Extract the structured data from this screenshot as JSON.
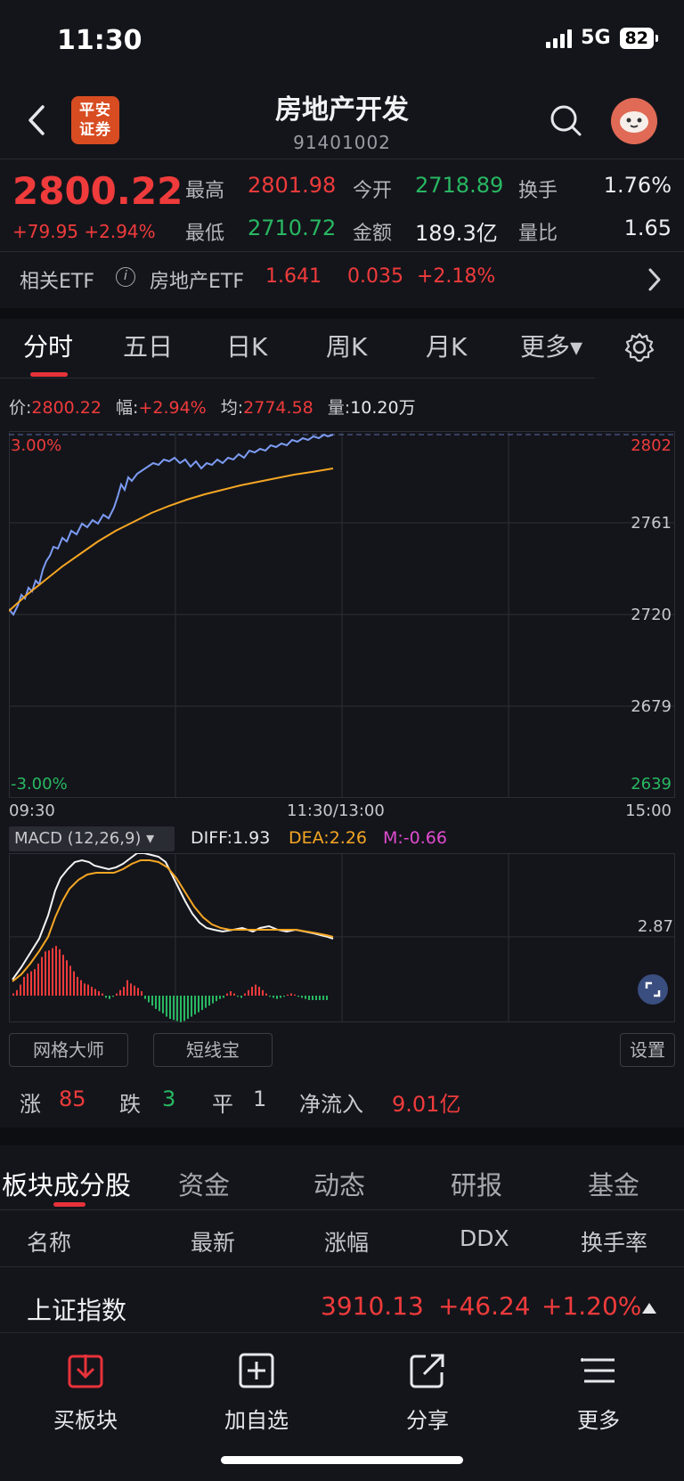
{
  "status": {
    "time": "11:30",
    "network": "5G",
    "battery": "82"
  },
  "header": {
    "logo_text_1": "平安",
    "logo_text_2": "证券",
    "title": "房地产开发",
    "code": "91401002"
  },
  "quote": {
    "price": "2800.22",
    "change": "+79.95 +2.94%",
    "high_label": "最高",
    "high": "2801.98",
    "open_label": "今开",
    "open": "2718.89",
    "turnover_label": "换手",
    "turnover": "1.76%",
    "low_label": "最低",
    "low": "2710.72",
    "amount_label": "金额",
    "amount": "189.3亿",
    "vol_ratio_label": "量比",
    "vol_ratio": "1.65"
  },
  "etf": {
    "label": "相关ETF",
    "info_icon": "i",
    "name": "房地产ETF",
    "price": "1.641",
    "change": "0.035",
    "pct": "+2.18%"
  },
  "tabs": [
    "分时",
    "五日",
    "日K",
    "周K",
    "月K",
    "更多▾"
  ],
  "infoline": {
    "price_label": "价:",
    "price": "2800.22",
    "amp_label": "幅:",
    "amp": "+2.94%",
    "avg_label": "均:",
    "avg": "2774.58",
    "vol_label": "量:",
    "vol": "10.20万"
  },
  "intraday": {
    "y_right": [
      "2802",
      "2761",
      "2720",
      "2679",
      "2639"
    ],
    "pct_top": "3.00%",
    "pct_bottom": "-3.00%",
    "x_labels": [
      "09:30",
      "11:30/13:00",
      "15:00"
    ]
  },
  "macd": {
    "label": "MACD (12,26,9) ▾",
    "diff": "DIFF:1.93",
    "dea": "DEA:2.26",
    "m": "M:-0.66",
    "right_value": "2.87"
  },
  "tools": {
    "grid": "网格大师",
    "short": "短线宝",
    "settings": "设置"
  },
  "stats": {
    "up_label": "涨",
    "up": "85",
    "down_label": "跌",
    "down": "3",
    "flat_label": "平",
    "flat": "1",
    "inflow_label": "净流入",
    "inflow": "9.01亿"
  },
  "sub_tabs": [
    "板块成分股",
    "资金",
    "动态",
    "研报",
    "基金"
  ],
  "columns": [
    "名称",
    "最新",
    "涨幅",
    "DDX",
    "换手率"
  ],
  "row": {
    "name": "上证指数",
    "last": "3910.13",
    "chg": "+46.24",
    "pct": "+1.20%"
  },
  "bottom": {
    "buy": "买板块",
    "add": "加自选",
    "share": "分享",
    "more": "更多"
  },
  "colors": {
    "up": "#ef3b3b",
    "down": "#28b862",
    "price_line": "#7c9cf2",
    "avg_line": "#f5a623",
    "accent": "#e8323a"
  }
}
